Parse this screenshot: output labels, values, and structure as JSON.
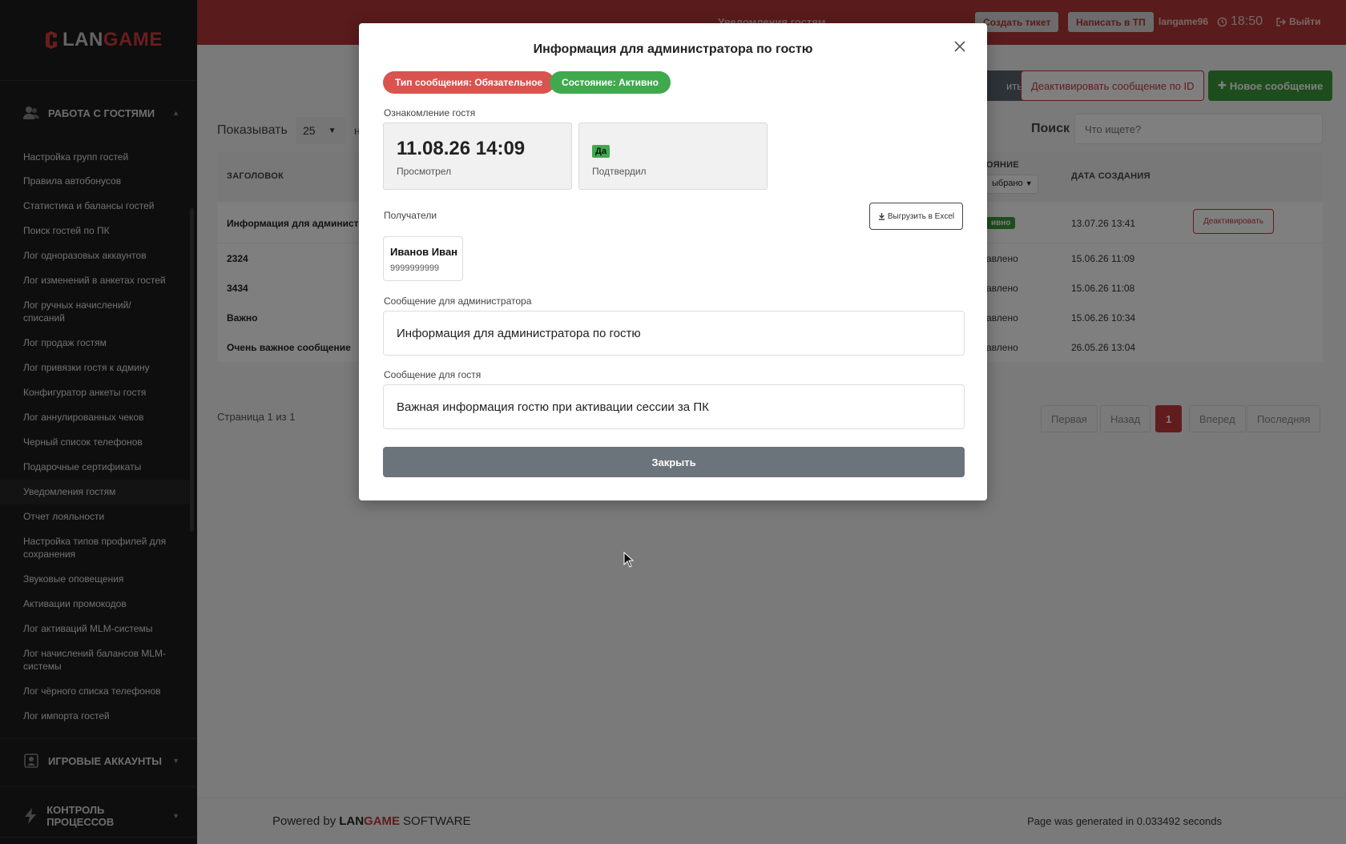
{
  "brand": {
    "lan": "LAN",
    "game": "GAME"
  },
  "sidebar": {
    "sections": [
      {
        "label": "РАБОТА С ГОСТЯМИ",
        "icon": "users-icon",
        "expanded": true
      },
      {
        "label": "ИГРОВЫЕ АККАУНТЫ",
        "icon": "account-icon",
        "expanded": false
      },
      {
        "label": "КОНТРОЛЬ ПРОЦЕССОВ",
        "icon": "bolt-icon",
        "expanded": false
      }
    ],
    "items": [
      "Настройка групп гостей",
      "Правила автобонусов",
      "Статистика и балансы гостей",
      "Поиск гостей по ПК",
      "Лог одноразовых аккаунтов",
      "Лог изменений в анкетах гостей",
      "Лог ручных начислений/ списаний",
      "Лог продаж гостям",
      "Лог привязки гостя к админу",
      "Конфигуратор анкеты гостя",
      "Лог аннулированных чеков",
      "Черный список телефонов",
      "Подарочные сертификаты",
      "Уведомления гостям",
      "Отчет лояльности",
      "Настройка типов профилей для сохранения",
      "Звуковые оповещения",
      "Активации промокодов",
      "Лог активаций MLM-системы",
      "Лог начислений балансов MLM-системы",
      "Лог чёрного списка телефонов",
      "Лог импорта гостей"
    ],
    "active_item": "Уведомления гостям"
  },
  "topbar": {
    "page_title": "Уведомления гостям",
    "create_ticket": "Создать тикет",
    "write_support": "Написать в ТП",
    "username": "langame96",
    "time": "18:50",
    "logout": "Выйти"
  },
  "main": {
    "actions": {
      "partial_button": "ить",
      "deactivate_by_id": "Деактивировать сообщение по ID",
      "new_message": "Новое сообщение"
    },
    "show_label": "Показывать",
    "show_value": "25",
    "show_partial": "н",
    "search_label": "Поиск",
    "search_placeholder": "Что ищете?",
    "table": {
      "headers": {
        "title": "ЗАГОЛОВОК",
        "state": "ОЯНИЕ",
        "created": "ДАТА СОЗДАНИЯ"
      },
      "state_filter": "ыбрано",
      "rows": [
        {
          "title": "Информация для администр",
          "state": "ивно",
          "date": "13.07.26 13:41",
          "action": "Деактивировать"
        },
        {
          "title": "2324",
          "state": "авлено",
          "date": "15.06.26 11:09"
        },
        {
          "title": "3434",
          "state": "авлено",
          "date": "15.06.26 11:08"
        },
        {
          "title": "Важно",
          "state": "авлено",
          "date": "15.06.26 10:34"
        },
        {
          "title": "Очень важное сообщение",
          "state": "авлено",
          "date": "26.05.26 13:04"
        }
      ]
    },
    "pager": {
      "text": "Страница 1 из 1",
      "first": "Первая",
      "prev": "Назад",
      "current": "1",
      "next": "Вперед",
      "last": "Последняя"
    },
    "footer": {
      "powered": "Powered by",
      "lan": "LAN",
      "game": "GAME",
      "software": "SOFTWARE",
      "generated": "Page was generated in 0.033492 seconds"
    }
  },
  "modal": {
    "title": "Информация для администратора по гостю",
    "type_pill": "Тип сообщения: Обязательное",
    "state_pill": "Состояние: Активно",
    "ack_label": "Ознакомление гостя",
    "viewed_datetime": "11.08.26 14:09",
    "viewed_label": "Просмотрел",
    "confirmed_badge": "Да",
    "confirmed_label": "Подтвердил",
    "recipients_label": "Получатели",
    "export_button": "Выгрузить в Excel",
    "recipient": {
      "name": "Иванов Иван",
      "phone": "9999999999"
    },
    "admin_msg_label": "Сообщение для администратора",
    "admin_msg": "Информация для администратора по гостю",
    "guest_msg_label": "Сообщение для гостя",
    "guest_msg": "Важная информация гостю при активации сессии за ПК",
    "close_button": "Закрыть"
  },
  "colors": {
    "topbar": "#b23636",
    "accent_red": "#c23a3a",
    "green": "#3fa94d",
    "pill_red": "#d9534f",
    "sidebar": "#1c1c1c"
  }
}
